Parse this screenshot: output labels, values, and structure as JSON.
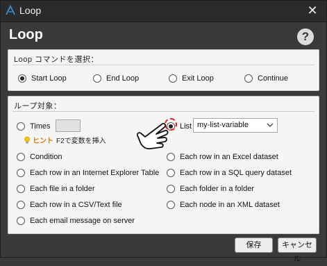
{
  "window": {
    "title": "Loop",
    "close_glyph": "✕"
  },
  "dialog": {
    "title": "Loop",
    "help_glyph": "?"
  },
  "command_group": {
    "header": "Loop コマンドを選択：",
    "options": [
      {
        "label": "Start Loop",
        "checked": true
      },
      {
        "label": "End Loop",
        "checked": false
      },
      {
        "label": "Exit Loop",
        "checked": false
      },
      {
        "label": "Continue",
        "checked": false
      }
    ]
  },
  "target_group": {
    "header": "ループ対象：",
    "times": {
      "label": "Times",
      "value": ""
    },
    "hint": {
      "label": "ヒント",
      "text": "F2で変数を挿入"
    },
    "list": {
      "label": "List",
      "selected": "my-list-variable"
    },
    "left_options": [
      "Condition",
      "Each row in an Internet Explorer Table",
      "Each file in a folder",
      "Each row in a CSV/Text file",
      "Each email message on server"
    ],
    "right_options": [
      "Each row in an Excel dataset",
      "Each row in a SQL query dataset",
      "Each folder in a folder",
      "Each node in an XML dataset"
    ]
  },
  "buttons": {
    "save": "保存",
    "cancel": "キャンセル"
  },
  "colors": {
    "accent_hint": "#e07a00",
    "focus_ring": "#e02020",
    "app_icon": "#3b8fd8"
  }
}
